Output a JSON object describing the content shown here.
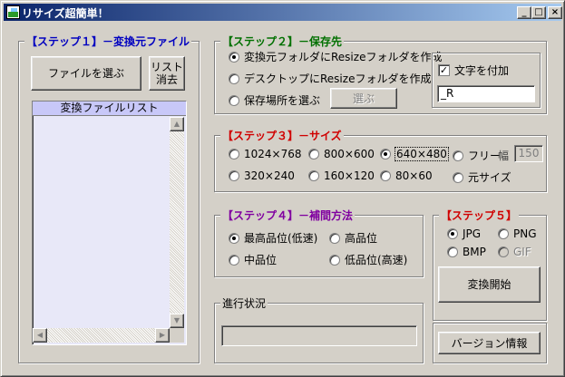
{
  "window": {
    "title": "リサイズ超簡単！",
    "controls": {
      "minimize": "_",
      "maximize": "□",
      "close": "×"
    }
  },
  "step1": {
    "legend": "【ステップ１】－変換元ファイル",
    "choose_button": "ファイルを選ぶ",
    "clear_button_line1": "リスト",
    "clear_button_line2": "消去",
    "list_header": "変換ファイルリスト",
    "scroll_up": "▲",
    "scroll_down": "▼",
    "scroll_left": "◀",
    "scroll_right": "▶"
  },
  "step2": {
    "legend": "【ステップ２】－保存先",
    "options": [
      {
        "label": "変換元フォルダにResizeフォルダを作成",
        "selected": true
      },
      {
        "label": "デスクトップにResizeフォルダを作成",
        "selected": false
      },
      {
        "label": "保存場所を選ぶ",
        "selected": false
      }
    ],
    "browse_button": "選ぶ",
    "add_text_label": "文字を付加",
    "add_text_checked": true,
    "add_text_checkmark": "✓",
    "add_text_value": "_R"
  },
  "step3": {
    "legend": "【ステップ３】－サイズ",
    "sizes": [
      {
        "label": "1024×768",
        "selected": false
      },
      {
        "label": "800×600",
        "selected": false
      },
      {
        "label": "640×480",
        "selected": true
      },
      {
        "label": "フリー",
        "selected": false
      },
      {
        "label": "320×240",
        "selected": false
      },
      {
        "label": "160×120",
        "selected": false
      },
      {
        "label": "80×60",
        "selected": false
      },
      {
        "label": "元サイズ",
        "selected": false
      }
    ],
    "width_label": "幅",
    "width_value": "150"
  },
  "step4": {
    "legend": "【ステップ４】－補間方法",
    "methods": [
      {
        "label": "最高品位(低速)",
        "selected": true
      },
      {
        "label": "高品位",
        "selected": false
      },
      {
        "label": "中品位",
        "selected": false
      },
      {
        "label": "低品位(高速)",
        "selected": false
      }
    ]
  },
  "step5": {
    "legend": "【ステップ５】",
    "formats": [
      {
        "label": "JPG",
        "selected": true,
        "disabled": false
      },
      {
        "label": "PNG",
        "selected": false,
        "disabled": false
      },
      {
        "label": "BMP",
        "selected": false,
        "disabled": false
      },
      {
        "label": "GIF",
        "selected": false,
        "disabled": true
      }
    ],
    "start_button": "変換開始"
  },
  "progress": {
    "legend": "進行状況",
    "value": 0
  },
  "version_button": "バージョン情報",
  "colors": {
    "title_start": "#0a246a",
    "title_end": "#a6caf0",
    "step1": "#0000c0",
    "step2": "#007000",
    "step3": "#d00000",
    "step4": "#8000a0",
    "step5": "#d00000",
    "list_header_bg": "#c8c8f8"
  }
}
